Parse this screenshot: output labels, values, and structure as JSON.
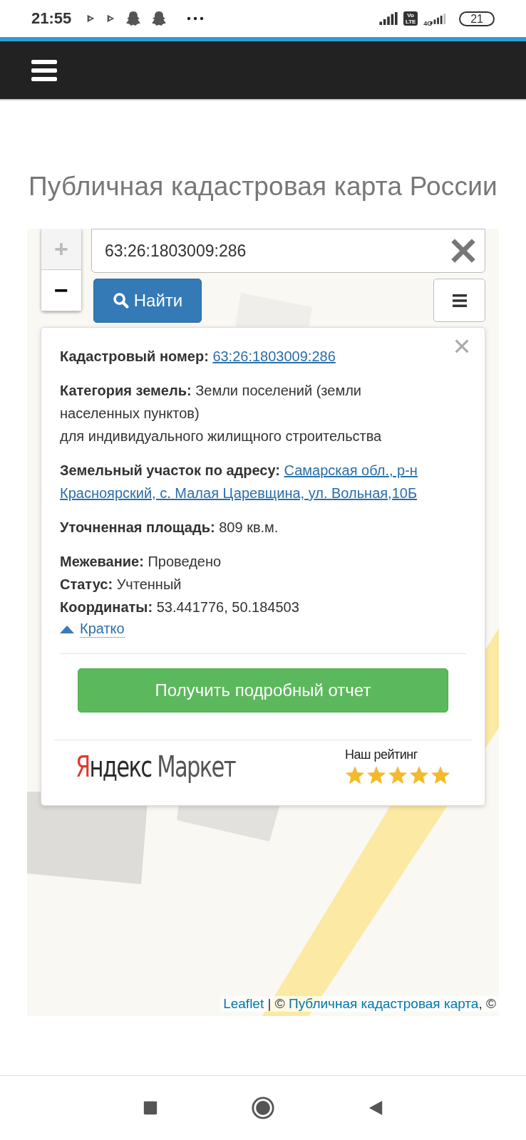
{
  "status_bar": {
    "time": "21:55",
    "volte": "Vo LTE",
    "network": "4G",
    "battery": "21"
  },
  "page_title": "Публичная кадастровая карта России",
  "map": {
    "kind": "picture",
    "zoom_in": {
      "label": "+",
      "disabled": true
    },
    "zoom_out": {
      "label": "−",
      "disabled": false
    },
    "search": {
      "value": "63:26:1803009:286"
    },
    "find_button": "Найти",
    "popup": {
      "groups": [
        [
          {
            "label": "Кадастровый номер:",
            "value": "63:26:1803009:286",
            "kind": "link"
          }
        ],
        [
          {
            "label": "Категория земель:",
            "value": "Земли поселений (земли населенных пунктов)\nдля индивидуального жилищного строительства",
            "kind": "text"
          }
        ],
        [
          {
            "label": "Земельный участок по адресу:",
            "value": "Самарская обл., р-н Красноярский, с. Малая Царевщина, ул. Вольная,10Б",
            "kind": "link"
          }
        ],
        [
          {
            "label": "Уточненная площадь:",
            "value": "809 кв.м.",
            "kind": "text"
          }
        ],
        [
          {
            "label": "Межевание:",
            "value": "Проведено",
            "kind": "text"
          },
          {
            "label": "Статус:",
            "value": "Учтенный",
            "kind": "text"
          },
          {
            "label": "Координаты:",
            "value": "53.441776, 50.184503",
            "kind": "text"
          }
        ]
      ],
      "collapse_link": "Кратко",
      "report_button": "Получить подробный отчет",
      "ad": {
        "logo": "Яндекс Маркет",
        "rating_label": "Наш рейтинг",
        "stars": 5
      }
    },
    "attribution": [
      {
        "text": "Leaflet",
        "kind": "link"
      },
      {
        "text": " | © ",
        "kind": "text"
      },
      {
        "text": "Публичная кадастровая карта",
        "kind": "link"
      },
      {
        "text": ", ©",
        "kind": "text"
      }
    ]
  }
}
